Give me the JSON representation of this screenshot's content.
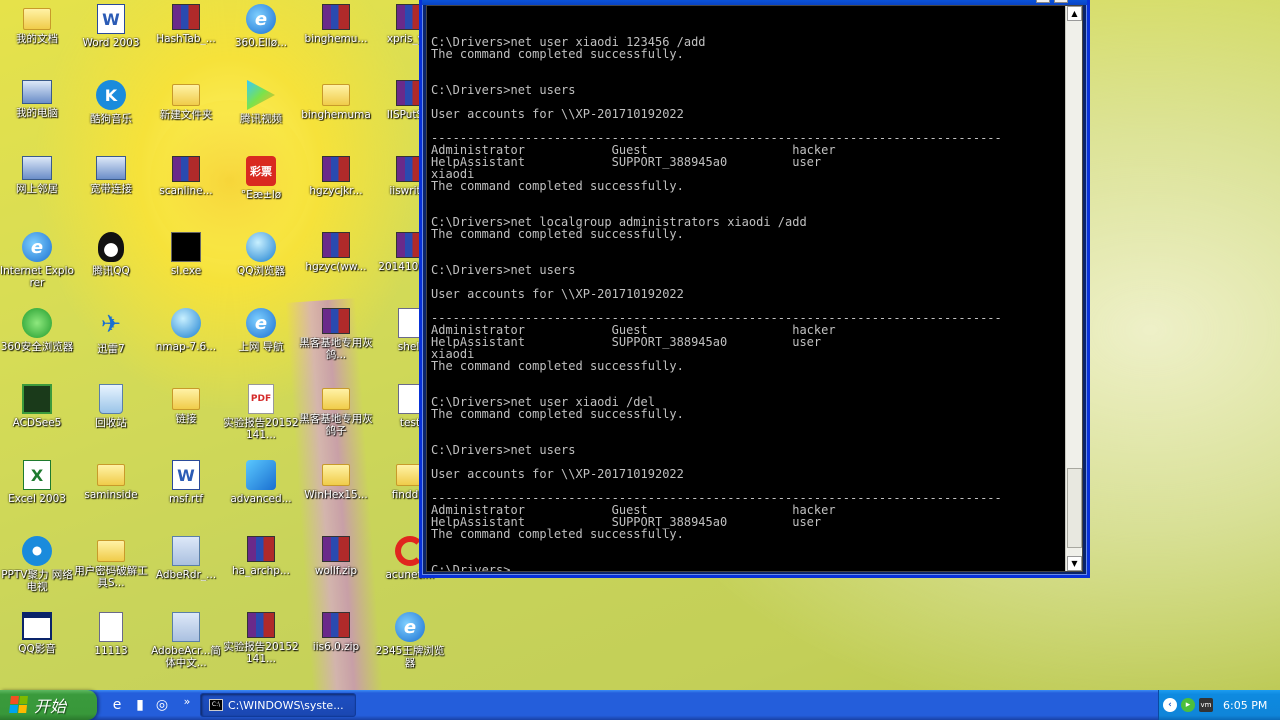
{
  "desktop": {
    "icons": [
      {
        "label": "我的文档",
        "icon": "my-documents-icon"
      },
      {
        "label": "Word 2003",
        "icon": "word-icon"
      },
      {
        "label": "HashTab_...",
        "icon": "winrar-archive-icon"
      },
      {
        "label": "360.Ellø...",
        "icon": "ie-icon"
      },
      {
        "label": "binghemu...",
        "icon": "winrar-archive-icon"
      },
      {
        "label": "xpris_v...",
        "icon": "winrar-archive-icon"
      },
      {
        "label": "我的电脑",
        "icon": "my-computer-icon"
      },
      {
        "label": "酷狗音乐",
        "icon": "kugou-icon"
      },
      {
        "label": "新建文件夹",
        "icon": "folder-icon"
      },
      {
        "label": "腾讯视频",
        "icon": "tencent-video-icon"
      },
      {
        "label": "binghemuma",
        "icon": "folder-icon"
      },
      {
        "label": "IISPutS...",
        "icon": "winrar-archive-icon"
      },
      {
        "label": "网上邻居",
        "icon": "network-places-icon"
      },
      {
        "label": "宽带连接",
        "icon": "broadband-connection-icon"
      },
      {
        "label": "scanline...",
        "icon": "winrar-archive-icon"
      },
      {
        "label": "°Eæ±lø",
        "icon": "lottery-icon"
      },
      {
        "label": "hgzycjkr...",
        "icon": "winrar-archive-icon"
      },
      {
        "label": "iiswrit...",
        "icon": "winrar-archive-icon"
      },
      {
        "label": "Internet Explorer",
        "icon": "ie-icon"
      },
      {
        "label": "腾讯QQ",
        "icon": "qq-icon"
      },
      {
        "label": "sl.exe",
        "icon": "exe-icon"
      },
      {
        "label": "QQ浏览器",
        "icon": "qq-browser-icon"
      },
      {
        "label": "hgzyc(ww...",
        "icon": "winrar-archive-icon"
      },
      {
        "label": "20141018...",
        "icon": "winrar-archive-icon"
      },
      {
        "label": "360安全浏览器",
        "icon": "360-browser-icon"
      },
      {
        "label": "迅雷7",
        "icon": "thunder-icon"
      },
      {
        "label": "nmap-7.6...",
        "icon": "nmap-installer-icon"
      },
      {
        "label": "上网 导航",
        "icon": "ie-icon"
      },
      {
        "label": "黑客基地专用灰鸽...",
        "icon": "winrar-archive-icon"
      },
      {
        "label": "shell",
        "icon": "document-icon"
      },
      {
        "label": "ACDSee5",
        "icon": "acdsee-icon"
      },
      {
        "label": "回收站",
        "icon": "recycle-bin-icon"
      },
      {
        "label": "链接",
        "icon": "folder-icon"
      },
      {
        "label": "实验报告20152141...",
        "icon": "pdf-icon"
      },
      {
        "label": "黑客基地专用灰鸽子",
        "icon": "folder-icon"
      },
      {
        "label": "test",
        "icon": "text-document-icon"
      },
      {
        "label": "Excel 2003",
        "icon": "excel-icon"
      },
      {
        "label": "saminside",
        "icon": "folder-icon"
      },
      {
        "label": "msf.rtf",
        "icon": "word-document-icon"
      },
      {
        "label": "advanced...",
        "icon": "advanced-app-icon"
      },
      {
        "label": "WinHex15...",
        "icon": "folder-icon"
      },
      {
        "label": "findd...",
        "icon": "folder-icon"
      },
      {
        "label": "PPTV聚力 网络电视",
        "icon": "pptv-icon"
      },
      {
        "label": "用户密码破解工具S...",
        "icon": "folder-icon"
      },
      {
        "label": "AdbeRdr_...",
        "icon": "adobe-installer-icon"
      },
      {
        "label": "ha_archp...",
        "icon": "winrar-archive-icon"
      },
      {
        "label": "wollf.zip",
        "icon": "winrar-archive-icon"
      },
      {
        "label": "acuneti...",
        "icon": "acunetix-icon"
      },
      {
        "label": "QQ影音",
        "icon": "qq-player-icon"
      },
      {
        "label": "11113",
        "icon": "document-icon"
      },
      {
        "label": "AdobeAcr...简体中文...",
        "icon": "adobe-installer-icon"
      },
      {
        "label": "实验报告20152141...",
        "icon": "winrar-archive-icon"
      },
      {
        "label": "iis6.0.zip",
        "icon": "winrar-archive-icon"
      },
      {
        "label": "2345王牌浏览器",
        "icon": "2345-browser-icon"
      }
    ]
  },
  "cmd_window": {
    "lines": [
      "C:\\Drivers>net user xiaodi 123456 /add",
      "The command completed successfully.",
      "",
      "",
      "C:\\Drivers>net users",
      "",
      "User accounts for \\\\XP-201710192022",
      "",
      "-------------------------------------------------------------------------------",
      "Administrator            Guest                    hacker",
      "HelpAssistant            SUPPORT_388945a0         user",
      "xiaodi",
      "The command completed successfully.",
      "",
      "",
      "C:\\Drivers>net localgroup administrators xiaodi /add",
      "The command completed successfully.",
      "",
      "",
      "C:\\Drivers>net users",
      "",
      "User accounts for \\\\XP-201710192022",
      "",
      "-------------------------------------------------------------------------------",
      "Administrator            Guest                    hacker",
      "HelpAssistant            SUPPORT_388945a0         user",
      "xiaodi",
      "The command completed successfully.",
      "",
      "",
      "C:\\Drivers>net user xiaodi /del",
      "The command completed successfully.",
      "",
      "",
      "C:\\Drivers>net users",
      "",
      "User accounts for \\\\XP-201710192022",
      "",
      "-------------------------------------------------------------------------------",
      "Administrator            Guest                    hacker",
      "HelpAssistant            SUPPORT_388945a0         user",
      "The command completed successfully.",
      "",
      "",
      "C:\\Drivers>"
    ]
  },
  "taskbar": {
    "start_label": "开始",
    "quick_launch": [
      "ie-icon",
      "media-icon",
      "browser-icon"
    ],
    "more": "»",
    "task_button_label": "C:\\WINDOWS\\syste...",
    "tray_icons": [
      "show-hidden-icon",
      "network-icon",
      "vmware-icon"
    ],
    "clock": "6:05 PM"
  }
}
